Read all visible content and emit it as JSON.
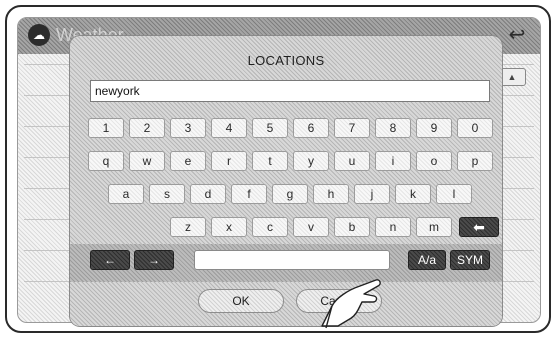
{
  "app": {
    "title": "Weather",
    "icon": "weather-app-icon",
    "back_icon": "back-arrow-icon"
  },
  "dialog": {
    "title": "LOCATIONS",
    "input_value": "newyork"
  },
  "keyboard": {
    "row1": [
      "1",
      "2",
      "3",
      "4",
      "5",
      "6",
      "7",
      "8",
      "9",
      "0"
    ],
    "row2": [
      "q",
      "w",
      "e",
      "r",
      "t",
      "y",
      "u",
      "i",
      "o",
      "p"
    ],
    "row3": [
      "a",
      "s",
      "d",
      "f",
      "g",
      "h",
      "j",
      "k",
      "l"
    ],
    "row4": [
      "z",
      "x",
      "c",
      "v",
      "b",
      "n",
      "m"
    ],
    "backspace_icon": "backspace-arrow-icon",
    "left_arrow": "←",
    "right_arrow": "→",
    "case_toggle": "A/a",
    "symbols": "SYM"
  },
  "buttons": {
    "ok": "OK",
    "cancel": "Cancel"
  }
}
